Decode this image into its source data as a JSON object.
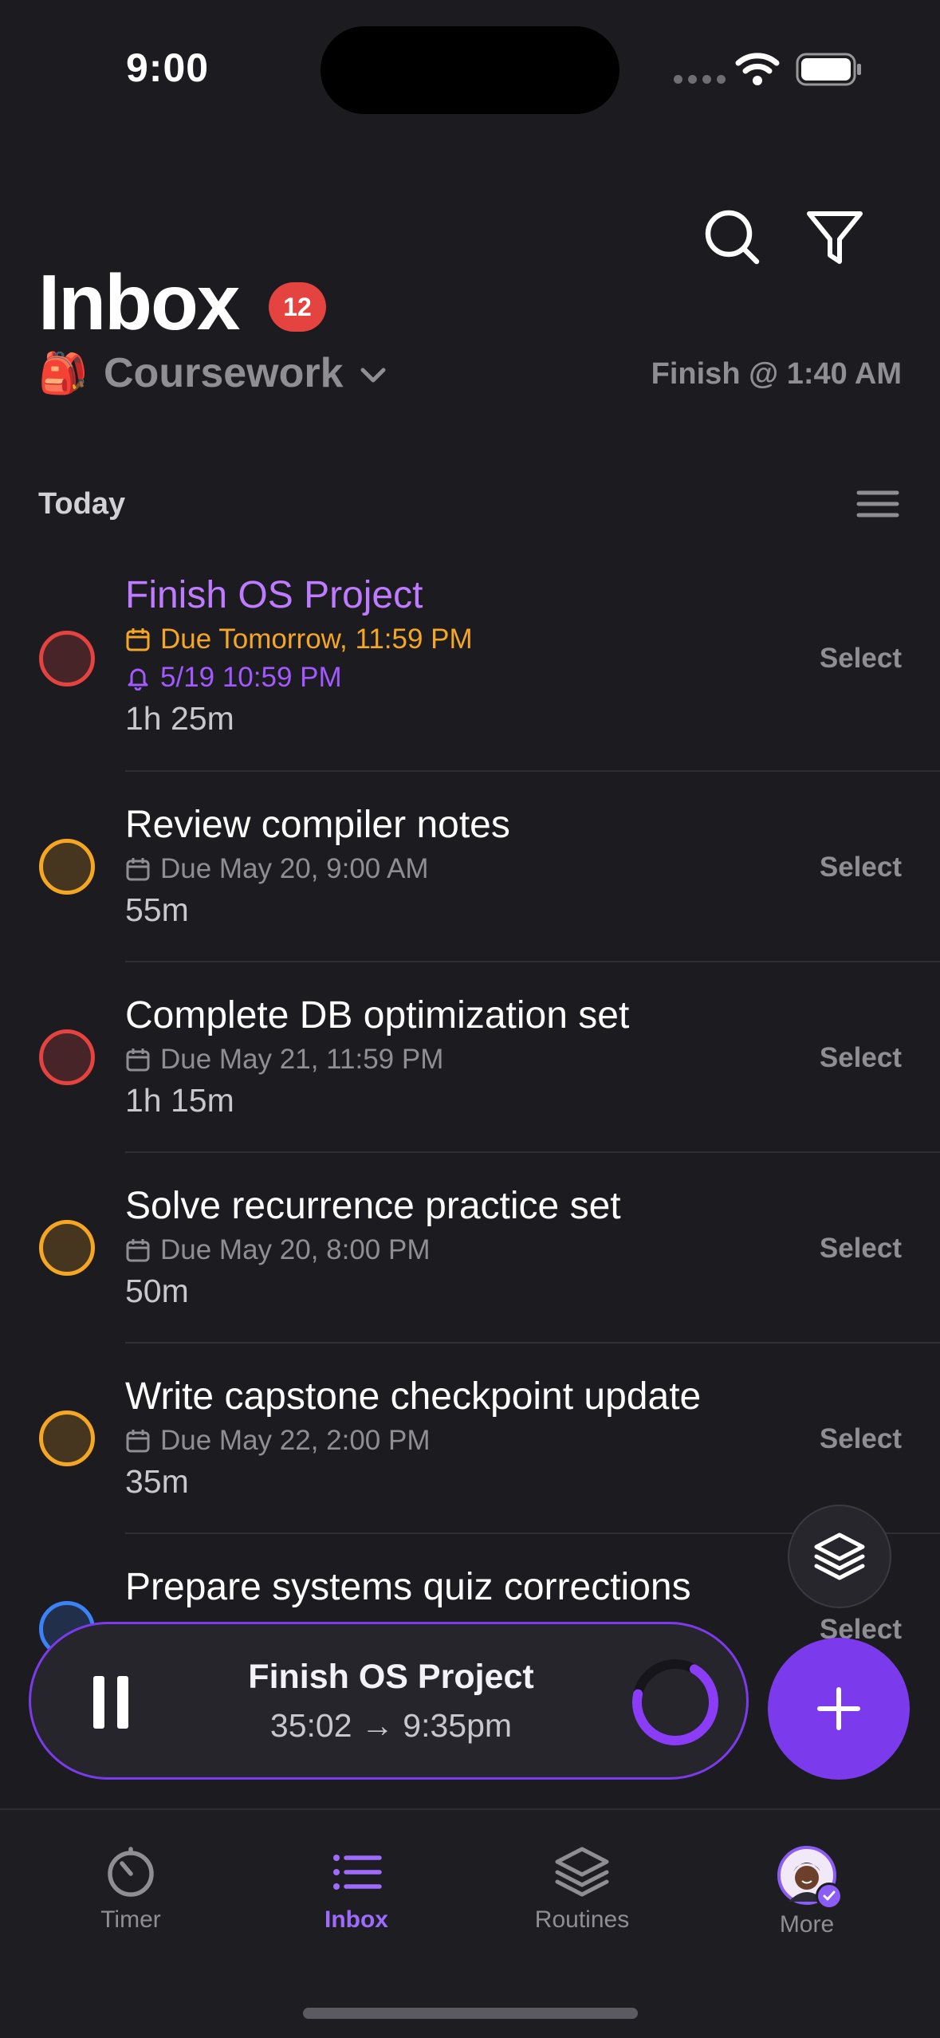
{
  "status_bar": {
    "time": "9:00"
  },
  "header": {
    "title": "Inbox",
    "badge_count": "12",
    "project_emoji": "🎒",
    "project_name": "Coursework",
    "finish_estimate": "Finish @ 1:40 AM"
  },
  "section": {
    "title": "Today"
  },
  "tasks": [
    {
      "title": "Finish OS Project",
      "title_color": "#bf7bff",
      "due": "Due Tomorrow, 11:59 PM",
      "due_color": "#f5a623",
      "reminder": "5/19 10:59 PM",
      "reminder_color": "#a259ff",
      "duration": "1h 25m",
      "priority_color": "#e5433f",
      "select_label": "Select"
    },
    {
      "title": "Review compiler notes",
      "due": "Due May 20, 9:00 AM",
      "duration": "55m",
      "priority_color": "#f5a623",
      "select_label": "Select"
    },
    {
      "title": "Complete DB optimization set",
      "due": "Due May 21, 11:59 PM",
      "duration": "1h 15m",
      "priority_color": "#e5433f",
      "select_label": "Select"
    },
    {
      "title": "Solve recurrence practice set",
      "due": "Due May 20, 8:00 PM",
      "duration": "50m",
      "priority_color": "#f5a623",
      "select_label": "Select"
    },
    {
      "title": "Write capstone checkpoint update",
      "due": "Due May 22, 2:00 PM",
      "duration": "35m",
      "priority_color": "#f5a623",
      "select_label": "Select"
    },
    {
      "title": "Prepare systems quiz corrections",
      "duration": "",
      "priority_color": "#3b82f6",
      "select_label": "Select"
    }
  ],
  "active_timer": {
    "task": "Finish OS Project",
    "remaining": "35:02 → 9:35pm",
    "progress": 0.7
  },
  "tabs": [
    {
      "label": "Timer",
      "icon": "timer-icon",
      "active": false
    },
    {
      "label": "Inbox",
      "icon": "list-icon",
      "active": true
    },
    {
      "label": "Routines",
      "icon": "layers-icon",
      "active": false
    },
    {
      "label": "More",
      "icon": "avatar",
      "active": false
    }
  ],
  "colors": {
    "accent": "#7c3aed",
    "background": "#1b1b20",
    "badge": "#e5433f"
  }
}
